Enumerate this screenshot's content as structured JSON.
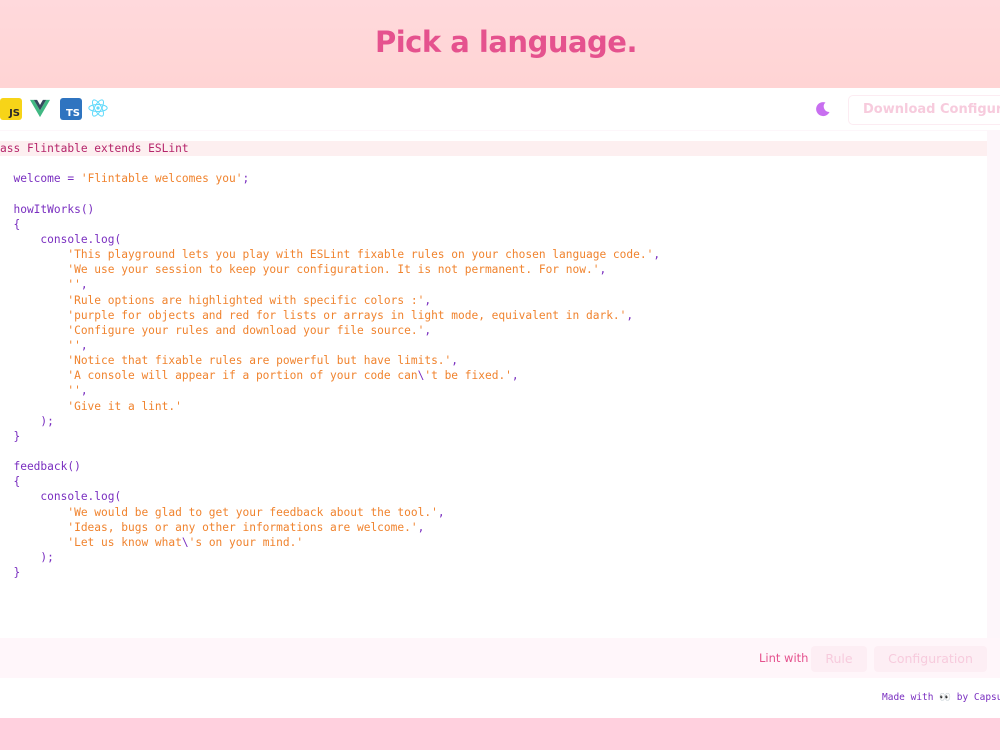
{
  "header": {
    "title": "Pick a language."
  },
  "toolbar": {
    "languages": [
      {
        "name": "javascript-icon",
        "badge": "JS",
        "color": "#f7d418"
      },
      {
        "name": "vue-icon",
        "color": "#41b883"
      },
      {
        "name": "typescript-icon",
        "badge": "TS",
        "color": "#2f74c0"
      },
      {
        "name": "react-icon",
        "color": "#61dafb"
      }
    ],
    "theme_icon": "moon-icon",
    "download_label": "Download Configuration"
  },
  "editor": {
    "lines": [
      [
        {
          "t": "kw",
          "v": "ass Flintable extends ESLint"
        }
      ],
      [],
      [
        {
          "t": "pp",
          "v": "  welcome "
        },
        {
          "t": "pp",
          "v": "= "
        },
        {
          "t": "str",
          "v": "'Flintable welcomes you'"
        },
        {
          "t": "pp",
          "v": ";"
        }
      ],
      [],
      [
        {
          "t": "pp",
          "v": "  howItWorks()"
        }
      ],
      [
        {
          "t": "pp",
          "v": "  {"
        }
      ],
      [
        {
          "t": "pp",
          "v": "      console.log("
        }
      ],
      [
        {
          "t": "str",
          "v": "          'This playground lets you play with ESLint fixable rules on your chosen language code.'"
        },
        {
          "t": "pp",
          "v": ","
        }
      ],
      [
        {
          "t": "str",
          "v": "          'We use your session to keep your configuration. It is not permanent. For now.'"
        },
        {
          "t": "pp",
          "v": ","
        }
      ],
      [
        {
          "t": "str",
          "v": "          ''"
        },
        {
          "t": "pp",
          "v": ","
        }
      ],
      [
        {
          "t": "str",
          "v": "          'Rule options are highlighted with specific colors :'"
        },
        {
          "t": "pp",
          "v": ","
        }
      ],
      [
        {
          "t": "str",
          "v": "          'purple for objects and red for lists or arrays in light mode, equivalent in dark.'"
        },
        {
          "t": "pp",
          "v": ","
        }
      ],
      [
        {
          "t": "str",
          "v": "          'Configure your rules and download your file source.'"
        },
        {
          "t": "pp",
          "v": ","
        }
      ],
      [
        {
          "t": "str",
          "v": "          ''"
        },
        {
          "t": "pp",
          "v": ","
        }
      ],
      [
        {
          "t": "str",
          "v": "          'Notice that fixable rules are powerful but have limits.'"
        },
        {
          "t": "pp",
          "v": ","
        }
      ],
      [
        {
          "t": "str",
          "v": "          'A console will appear if a portion of your code can"
        },
        {
          "t": "pp",
          "v": "\\"
        },
        {
          "t": "str",
          "v": "'t be fixed.'"
        },
        {
          "t": "pp",
          "v": ","
        }
      ],
      [
        {
          "t": "str",
          "v": "          ''"
        },
        {
          "t": "pp",
          "v": ","
        }
      ],
      [
        {
          "t": "str",
          "v": "          'Give it a lint.'"
        }
      ],
      [
        {
          "t": "pp",
          "v": "      );"
        }
      ],
      [
        {
          "t": "pp",
          "v": "  }"
        }
      ],
      [],
      [
        {
          "t": "pp",
          "v": "  feedback()"
        }
      ],
      [
        {
          "t": "pp",
          "v": "  {"
        }
      ],
      [
        {
          "t": "pp",
          "v": "      console.log("
        }
      ],
      [
        {
          "t": "str",
          "v": "          'We would be glad to get your feedback about the tool.'"
        },
        {
          "t": "pp",
          "v": ","
        }
      ],
      [
        {
          "t": "str",
          "v": "          'Ideas, bugs or any other informations are welcome.'"
        },
        {
          "t": "pp",
          "v": ","
        }
      ],
      [
        {
          "t": "str",
          "v": "          'Let us know what"
        },
        {
          "t": "pp",
          "v": "\\"
        },
        {
          "t": "str",
          "v": "'s on your mind.'"
        }
      ],
      [
        {
          "t": "pp",
          "v": "      );"
        }
      ],
      [
        {
          "t": "pp",
          "v": "  }"
        }
      ]
    ]
  },
  "lint_bar": {
    "label": "Lint with",
    "rule_label": "Rule",
    "configuration_label": "Configuration"
  },
  "footer": {
    "made_with": "Made with 👀 by Capsu"
  },
  "colors": {
    "title": "#e5528e",
    "keyword": "#b5246a",
    "punct": "#7a2fc0",
    "string": "#f0832e"
  }
}
